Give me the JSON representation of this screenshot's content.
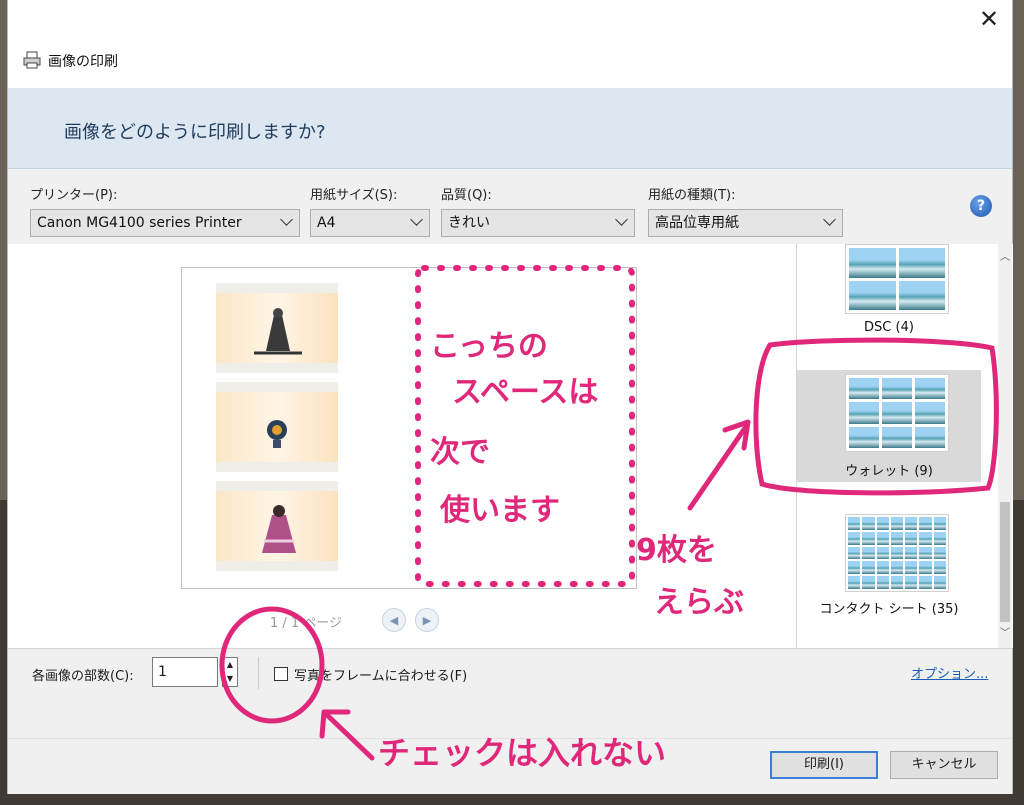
{
  "window": {
    "title": "画像の印刷",
    "close_glyph": "✕",
    "banner": "画像をどのように印刷しますか?"
  },
  "settings": {
    "printer": {
      "label": "プリンター(P):",
      "value": "Canon MG4100 series Printer"
    },
    "paper_size": {
      "label": "用紙サイズ(S):",
      "value": "A4"
    },
    "quality": {
      "label": "品質(Q):",
      "value": "きれい"
    },
    "paper_type": {
      "label": "用紙の種類(T):",
      "value": "高品位専用紙"
    },
    "help_glyph": "?"
  },
  "preview": {
    "pager": "1 / 1 ページ",
    "prev_glyph": "◀",
    "next_glyph": "▶"
  },
  "layouts": [
    {
      "label": "DSC (4)"
    },
    {
      "label": "ウォレット (9)",
      "selected": true
    },
    {
      "label": "コンタクト シート (35)"
    }
  ],
  "bottom": {
    "copies_label": "各画像の部数(C):",
    "copies_value": "1",
    "fit_label": "写真をフレームに合わせる(F)",
    "fit_checked": false,
    "options_link": "オプション..."
  },
  "buttons": {
    "print": "印刷(I)",
    "cancel": "キャンセル"
  },
  "annotations": {
    "space_note": [
      "こっちの",
      "スペースは",
      "次で",
      "使います"
    ],
    "pick_note": [
      "9枚を",
      "えらぶ"
    ],
    "check_note": "チェックは入れない",
    "color": "#e0287a"
  }
}
